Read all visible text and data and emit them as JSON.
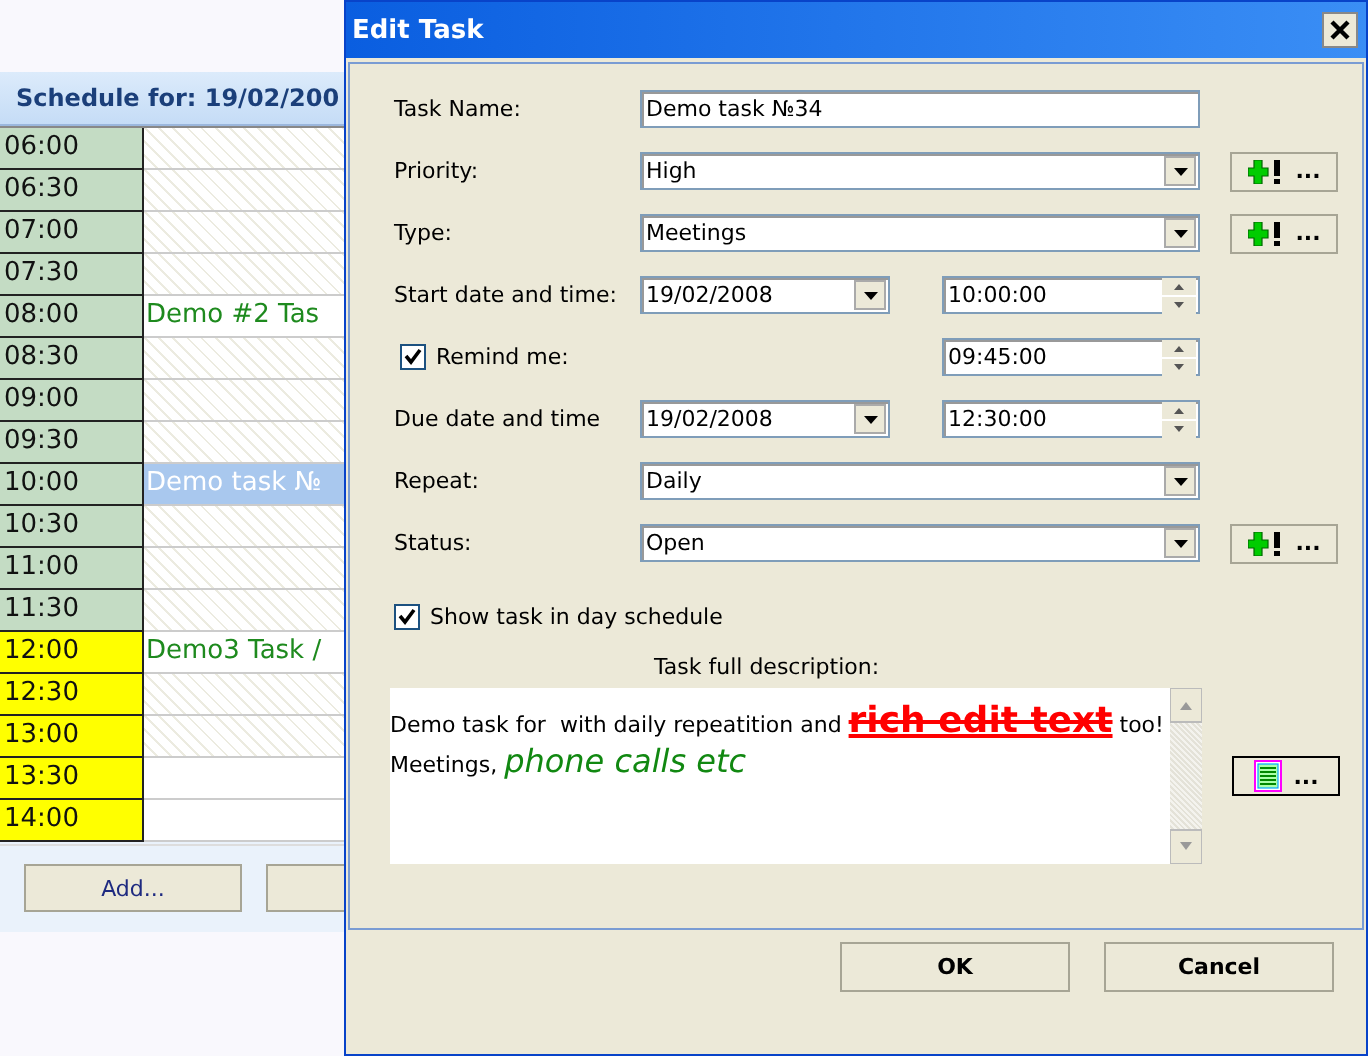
{
  "schedule": {
    "title": "Schedule for: 19/02/200",
    "rows": [
      {
        "time": "06:00",
        "color": "#c4dcc4",
        "busy": true,
        "task": "",
        "selected": false
      },
      {
        "time": "06:30",
        "color": "#c4dcc4",
        "busy": true,
        "task": "",
        "selected": false
      },
      {
        "time": "07:00",
        "color": "#c4dcc4",
        "busy": true,
        "task": "",
        "selected": false
      },
      {
        "time": "07:30",
        "color": "#c4dcc4",
        "busy": true,
        "task": "",
        "selected": false
      },
      {
        "time": "08:00",
        "color": "#c4dcc4",
        "busy": false,
        "task": "Demo #2 Tas",
        "selected": false
      },
      {
        "time": "08:30",
        "color": "#c4dcc4",
        "busy": true,
        "task": "",
        "selected": false
      },
      {
        "time": "09:00",
        "color": "#c4dcc4",
        "busy": true,
        "task": "",
        "selected": false
      },
      {
        "time": "09:30",
        "color": "#c4dcc4",
        "busy": true,
        "task": "",
        "selected": false
      },
      {
        "time": "10:00",
        "color": "#c4dcc4",
        "busy": false,
        "task": "Demo task №",
        "selected": true
      },
      {
        "time": "10:30",
        "color": "#c4dcc4",
        "busy": true,
        "task": "",
        "selected": false
      },
      {
        "time": "11:00",
        "color": "#c4dcc4",
        "busy": true,
        "task": "",
        "selected": false
      },
      {
        "time": "11:30",
        "color": "#c4dcc4",
        "busy": true,
        "task": "",
        "selected": false
      },
      {
        "time": "12:00",
        "color": "#ffff00",
        "busy": false,
        "task": "Demo3 Task /",
        "selected": false
      },
      {
        "time": "12:30",
        "color": "#ffff00",
        "busy": true,
        "task": "",
        "selected": false
      },
      {
        "time": "13:00",
        "color": "#ffff00",
        "busy": true,
        "task": "",
        "selected": false
      },
      {
        "time": "13:30",
        "color": "#ffff00",
        "busy": false,
        "task": "",
        "selected": false
      },
      {
        "time": "14:00",
        "color": "#ffff00",
        "busy": false,
        "task": "",
        "selected": false
      }
    ],
    "add_button": "Add..."
  },
  "dialog": {
    "title": "Edit Task",
    "fields": [
      {
        "kind": "text",
        "label": "Task Name:",
        "value": "Demo task №34"
      },
      {
        "kind": "combo",
        "label": "Priority:",
        "value": "High",
        "button": "..."
      },
      {
        "kind": "combo",
        "label": "Type:",
        "value": "Meetings",
        "button": "..."
      },
      {
        "kind": "datetime",
        "label": "Start date and time:",
        "date": "19/02/2008",
        "time": "10:00:00"
      },
      {
        "kind": "remind",
        "label": "Remind me:",
        "checked": true,
        "time": "09:45:00"
      },
      {
        "kind": "datetime",
        "label": "Due date and time",
        "date": "19/02/2008",
        "time": "12:30:00"
      },
      {
        "kind": "combo",
        "label": "Repeat:",
        "value": "Daily"
      },
      {
        "kind": "combo",
        "label": "Status:",
        "value": "Open",
        "button": "..."
      }
    ],
    "show_in_schedule": {
      "label": "Show task in day schedule",
      "checked": true
    },
    "description_label": "Task full description:",
    "description": [
      "Demo task for  with daily repeatition and **rich edit text** too!",
      "Meetings, *phone calls etc*"
    ],
    "format_button": "...",
    "buttons": [
      "OK",
      "Cancel"
    ]
  }
}
